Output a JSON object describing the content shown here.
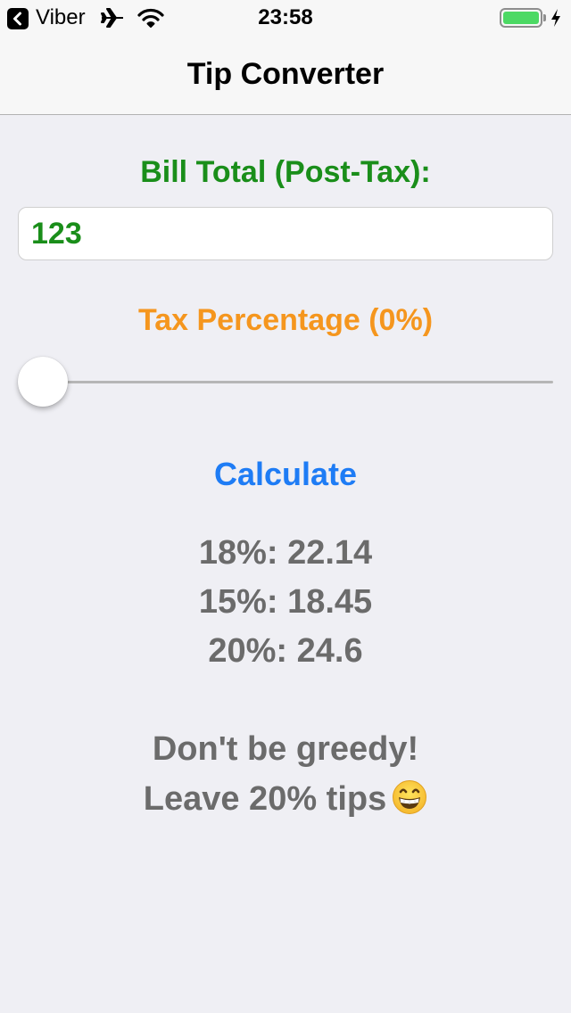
{
  "status_bar": {
    "back_app": "Viber",
    "time": "23:58",
    "battery_level": 1.0,
    "icons": [
      "back-arrow-icon",
      "airplane-icon",
      "wifi-icon",
      "battery-icon",
      "charging-bolt-icon"
    ],
    "battery_color": "#4cd964"
  },
  "nav": {
    "title": "Tip Converter"
  },
  "bill": {
    "label": "Bill Total (Post-Tax):",
    "value": "123",
    "color": "#1a8e1a"
  },
  "tax": {
    "label": "Tax Percentage (0%)",
    "slider_value": 0,
    "color": "#f5961e"
  },
  "calculate": {
    "label": "Calculate",
    "color": "#1e7cf5"
  },
  "results": [
    "18%: 22.14",
    "15%: 18.45",
    "20%: 24.6"
  ],
  "message": {
    "line1": "Don't be greedy!",
    "line2": "Leave 20% tips",
    "emoji": "grinning-face-icon"
  }
}
